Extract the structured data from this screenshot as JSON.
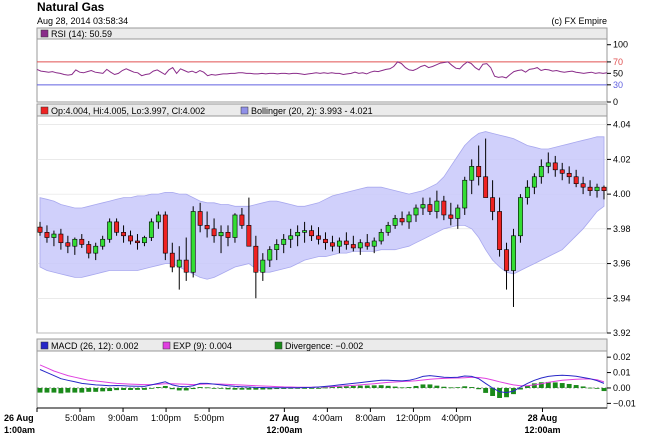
{
  "header": {
    "title": "Natural Gas",
    "timestamp": "Aug 28, 2014 03:58:34",
    "copyright": "(c) FX Empire"
  },
  "colors": {
    "rsi_line": "#8a2c8a",
    "rsi_upper": "#e05050",
    "rsi_lower": "#6060e0",
    "band_fill": "#c8c8fa",
    "band_edge": "#a8a8ee",
    "candle_up": "#33dd33",
    "candle_down": "#ee2222",
    "macd_line": "#2828c8",
    "exp_line": "#e040e0",
    "divergence": "#1a8a1a",
    "panel_header": "#ebebeb",
    "grid": "#dddddd"
  },
  "chart_data": [
    {
      "type": "line",
      "name": "rsi-panel",
      "legend": "RSI (14): 50.59",
      "legend_color": "#8a2c8a",
      "ylim": [
        0,
        110
      ],
      "yticks": [
        100,
        70,
        50,
        30,
        0
      ],
      "levels": [
        70,
        30
      ],
      "values": [
        57,
        54,
        53,
        52,
        53,
        51,
        50,
        48,
        47,
        48,
        56,
        52,
        51,
        53,
        55,
        52,
        51,
        50,
        57,
        52,
        48,
        50,
        55,
        58,
        55,
        52,
        51,
        46,
        48,
        49,
        54,
        56,
        52,
        48,
        56,
        60,
        50,
        58,
        55,
        52,
        54,
        51,
        55,
        52,
        46,
        48,
        47,
        48,
        49,
        49,
        50,
        50,
        51,
        51,
        50,
        50,
        49,
        49,
        50,
        49,
        50,
        50,
        49,
        50,
        50,
        49,
        50,
        50,
        49,
        48,
        49,
        50,
        51,
        50,
        51,
        50,
        51,
        50,
        50,
        48,
        49,
        50,
        52,
        50,
        51,
        49,
        52,
        54,
        53,
        55,
        57,
        58,
        62,
        70,
        67,
        60,
        56,
        55,
        58,
        62,
        64,
        60,
        62,
        65,
        68,
        69,
        70,
        64,
        59,
        58,
        65,
        70,
        67,
        60,
        56,
        66,
        67,
        60,
        45,
        43,
        44,
        42,
        48,
        53,
        55,
        56,
        52,
        57,
        58,
        60,
        55,
        57,
        56,
        54,
        55,
        53,
        52,
        53,
        54,
        52,
        51,
        50,
        51,
        52,
        50,
        51,
        50,
        51
      ]
    },
    {
      "type": "candlestick",
      "name": "price-panel",
      "legend": "Op:4.004, Hi:4.005, Lo:3.997, Cl:4.002",
      "legend_color": "#ee2222",
      "band_legend": "Bollinger (20, 2): 3.993 - 4.021",
      "band_legend_color": "#9090e8",
      "ylim": [
        3.92,
        4.045
      ],
      "yticks": [
        4.04,
        4.02,
        4.0,
        3.98,
        3.96,
        3.94,
        3.92
      ],
      "ytick_labels": [
        "4.04",
        "4.02",
        "4.00",
        "3.98",
        "3.96",
        "3.94",
        "3.92"
      ],
      "candles": [
        [
          3.981,
          3.984,
          3.976,
          3.978
        ],
        [
          3.978,
          3.982,
          3.972,
          3.975
        ],
        [
          3.975,
          3.979,
          3.97,
          3.977
        ],
        [
          3.977,
          3.98,
          3.968,
          3.972
        ],
        [
          3.972,
          3.976,
          3.966,
          3.97
        ],
        [
          3.97,
          3.975,
          3.965,
          3.974
        ],
        [
          3.974,
          3.977,
          3.969,
          3.971
        ],
        [
          3.971,
          3.973,
          3.963,
          3.966
        ],
        [
          3.966,
          3.972,
          3.962,
          3.97
        ],
        [
          3.97,
          3.976,
          3.968,
          3.974
        ],
        [
          3.974,
          3.986,
          3.972,
          3.984
        ],
        [
          3.984,
          3.986,
          3.976,
          3.978
        ],
        [
          3.978,
          3.982,
          3.972,
          3.976
        ],
        [
          3.976,
          3.979,
          3.971,
          3.973
        ],
        [
          3.973,
          3.977,
          3.968,
          3.972
        ],
        [
          3.972,
          3.976,
          3.97,
          3.975
        ],
        [
          3.975,
          3.986,
          3.973,
          3.984
        ],
        [
          3.984,
          3.99,
          3.98,
          3.988
        ],
        [
          3.988,
          3.99,
          3.962,
          3.966
        ],
        [
          3.966,
          3.972,
          3.955,
          3.958
        ],
        [
          3.958,
          3.97,
          3.945,
          3.962
        ],
        [
          3.962,
          3.975,
          3.95,
          3.955
        ],
        [
          3.955,
          3.993,
          3.952,
          3.99
        ],
        [
          3.99,
          3.995,
          3.978,
          3.982
        ],
        [
          3.982,
          3.99,
          3.975,
          3.98
        ],
        [
          3.98,
          3.986,
          3.972,
          3.976
        ],
        [
          3.976,
          3.982,
          3.966,
          3.978
        ],
        [
          3.978,
          3.982,
          3.97,
          3.975
        ],
        [
          3.975,
          3.989,
          3.972,
          3.988
        ],
        [
          3.988,
          3.992,
          3.98,
          3.982
        ],
        [
          3.982,
          3.998,
          3.978,
          3.97
        ],
        [
          3.97,
          3.976,
          3.94,
          3.955
        ],
        [
          3.955,
          3.966,
          3.95,
          3.962
        ],
        [
          3.962,
          3.97,
          3.958,
          3.968
        ],
        [
          3.968,
          3.974,
          3.962,
          3.971
        ],
        [
          3.971,
          3.977,
          3.966,
          3.974
        ],
        [
          3.974,
          3.98,
          3.969,
          3.976
        ],
        [
          3.976,
          3.982,
          3.97,
          3.978
        ],
        [
          3.978,
          3.984,
          3.972,
          3.979
        ],
        [
          3.979,
          3.982,
          3.973,
          3.976
        ],
        [
          3.976,
          3.981,
          3.971,
          3.974
        ],
        [
          3.974,
          3.978,
          3.968,
          3.972
        ],
        [
          3.972,
          3.976,
          3.967,
          3.97
        ],
        [
          3.97,
          3.975,
          3.966,
          3.973
        ],
        [
          3.973,
          3.978,
          3.968,
          3.971
        ],
        [
          3.971,
          3.976,
          3.967,
          3.969
        ],
        [
          3.969,
          3.974,
          3.965,
          3.972
        ],
        [
          3.972,
          3.977,
          3.968,
          3.97
        ],
        [
          3.97,
          3.975,
          3.966,
          3.973
        ],
        [
          3.973,
          3.98,
          3.971,
          3.978
        ],
        [
          3.978,
          3.984,
          3.976,
          3.982
        ],
        [
          3.982,
          3.988,
          3.98,
          3.986
        ],
        [
          3.986,
          3.99,
          3.982,
          3.984
        ],
        [
          3.984,
          3.99,
          3.98,
          3.988
        ],
        [
          3.988,
          3.994,
          3.984,
          3.992
        ],
        [
          3.992,
          3.998,
          3.988,
          3.994
        ],
        [
          3.994,
          3.998,
          3.988,
          3.99
        ],
        [
          3.99,
          4.002,
          3.986,
          3.996
        ],
        [
          3.996,
          3.999,
          3.985,
          3.988
        ],
        [
          3.988,
          3.995,
          3.982,
          3.986
        ],
        [
          3.986,
          3.994,
          3.98,
          3.992
        ],
        [
          3.992,
          4.01,
          3.988,
          4.008
        ],
        [
          4.008,
          4.02,
          4.0,
          4.016
        ],
        [
          4.016,
          4.028,
          4.005,
          4.01
        ],
        [
          4.01,
          4.032,
          4.006,
          3.998
        ],
        [
          3.998,
          4.008,
          3.985,
          3.99
        ],
        [
          3.99,
          3.998,
          3.964,
          3.968
        ],
        [
          3.968,
          3.972,
          3.945,
          3.956
        ],
        [
          3.956,
          3.98,
          3.935,
          3.976
        ],
        [
          3.976,
          4.0,
          3.972,
          3.998
        ],
        [
          3.998,
          4.008,
          3.994,
          4.004
        ],
        [
          4.004,
          4.012,
          4.0,
          4.01
        ],
        [
          4.01,
          4.02,
          4.006,
          4.016
        ],
        [
          4.016,
          4.024,
          4.012,
          4.018
        ],
        [
          4.018,
          4.022,
          4.01,
          4.014
        ],
        [
          4.014,
          4.018,
          4.008,
          4.012
        ],
        [
          4.012,
          4.016,
          4.006,
          4.01
        ],
        [
          4.01,
          4.014,
          4.004,
          4.006
        ],
        [
          4.006,
          4.01,
          4.0,
          4.004
        ],
        [
          4.004,
          4.008,
          3.999,
          4.002
        ],
        [
          4.002,
          4.006,
          3.998,
          4.004
        ],
        [
          4.004,
          4.005,
          3.997,
          4.002
        ]
      ],
      "band_upper": [
        3.998,
        3.997,
        3.996,
        3.994,
        3.993,
        3.992,
        3.992,
        3.993,
        3.994,
        3.995,
        3.996,
        3.997,
        3.998,
        3.998,
        3.999,
        3.999,
        4.0,
        4.0,
        4.001,
        4.001,
        4.0,
        4.0,
        3.998,
        3.996,
        3.995,
        3.995,
        3.994,
        3.994,
        3.993,
        3.993,
        3.993,
        3.994,
        3.995,
        3.996,
        3.996,
        3.995,
        3.994,
        3.993,
        3.993,
        3.994,
        3.995,
        3.997,
        3.999,
        4.0,
        4.001,
        4.002,
        4.003,
        4.004,
        4.004,
        4.004,
        4.003,
        4.002,
        4.001,
        4.0,
        4.001,
        4.002,
        4.004,
        4.006,
        4.01,
        4.016,
        4.022,
        4.028,
        4.032,
        4.035,
        4.036,
        4.035,
        4.034,
        4.033,
        4.032,
        4.03,
        4.028,
        4.027,
        4.026,
        4.026,
        4.027,
        4.028,
        4.029,
        4.03,
        4.031,
        4.032,
        4.033,
        4.033
      ],
      "band_lower": [
        3.958,
        3.956,
        3.955,
        3.954,
        3.953,
        3.952,
        3.952,
        3.953,
        3.954,
        3.955,
        3.956,
        3.956,
        3.956,
        3.956,
        3.956,
        3.957,
        3.958,
        3.959,
        3.96,
        3.96,
        3.958,
        3.956,
        3.954,
        3.952,
        3.951,
        3.952,
        3.954,
        3.956,
        3.958,
        3.959,
        3.96,
        3.957,
        3.955,
        3.955,
        3.956,
        3.957,
        3.958,
        3.96,
        3.962,
        3.963,
        3.964,
        3.964,
        3.965,
        3.966,
        3.966,
        3.967,
        3.967,
        3.967,
        3.967,
        3.968,
        3.968,
        3.968,
        3.969,
        3.97,
        3.972,
        3.974,
        3.976,
        3.978,
        3.98,
        3.981,
        3.982,
        3.982,
        3.98,
        3.975,
        3.968,
        3.962,
        3.958,
        3.955,
        3.954,
        3.956,
        3.958,
        3.96,
        3.962,
        3.964,
        3.966,
        3.968,
        3.972,
        3.976,
        3.98,
        3.985,
        3.99,
        3.993
      ]
    },
    {
      "type": "line",
      "name": "macd-panel",
      "ylim": [
        -0.013,
        0.024
      ],
      "yticks": [
        0.02,
        0.01,
        0.0,
        -0.01
      ],
      "ytick_labels": [
        "0.02",
        "0.01",
        "0.00",
        "−0.01"
      ],
      "legend": [
        {
          "label": "MACD (26, 12): 0.002",
          "color": "#2828c8"
        },
        {
          "label": "EXP (9): 0.004",
          "color": "#e040e0"
        },
        {
          "label": "Divergence: −0.002",
          "color": "#1a8a1a"
        }
      ],
      "series": [
        {
          "values": [
            0.012,
            0.01,
            0.008,
            0.006,
            0.005,
            0.004,
            0.003,
            0.0025,
            0.002,
            0.0018,
            0.0015,
            0.0016,
            0.0014,
            0.0012,
            0.0011,
            0.001,
            0.002,
            0.003,
            0.004,
            0.002,
            0.001,
            0.0008,
            0.0015,
            0.003,
            0.003,
            0.0025,
            0.002,
            0.0014,
            0.001,
            0.0008,
            0.0006,
            0.0004,
            0.0003,
            0.0002,
            0.0002,
            0.0001,
            0.0001,
            0.0002,
            0.0003,
            0.0004,
            0.0006,
            0.001,
            0.0015,
            0.002,
            0.0025,
            0.003,
            0.0035,
            0.004,
            0.0045,
            0.005,
            0.005,
            0.0048,
            0.0046,
            0.005,
            0.006,
            0.0075,
            0.008,
            0.0075,
            0.007,
            0.0068,
            0.007,
            0.0078,
            0.0075,
            0.006,
            0.003,
            0.0,
            -0.0025,
            -0.003,
            -0.002,
            0.0005,
            0.003,
            0.005,
            0.0065,
            0.0075,
            0.008,
            0.0082,
            0.008,
            0.0076,
            0.0068,
            0.006,
            0.0048,
            0.003
          ]
        },
        {
          "values": [
            0.015,
            0.013,
            0.011,
            0.0095,
            0.008,
            0.007,
            0.006,
            0.005,
            0.0045,
            0.004,
            0.0035,
            0.003,
            0.0027,
            0.0025,
            0.0023,
            0.0022,
            0.0022,
            0.0024,
            0.0027,
            0.0028,
            0.0026,
            0.0024,
            0.0022,
            0.0024,
            0.0026,
            0.0026,
            0.0025,
            0.0023,
            0.0021,
            0.0019,
            0.0017,
            0.0015,
            0.0013,
            0.0011,
            0.0009,
            0.0007,
            0.0006,
            0.0005,
            0.0005,
            0.0005,
            0.0006,
            0.0007,
            0.0009,
            0.0011,
            0.0014,
            0.0017,
            0.002,
            0.0024,
            0.0028,
            0.0032,
            0.0036,
            0.0039,
            0.0042,
            0.0044,
            0.0047,
            0.0052,
            0.0057,
            0.006,
            0.0062,
            0.0064,
            0.0065,
            0.0067,
            0.0069,
            0.0068,
            0.0062,
            0.0052,
            0.004,
            0.003,
            0.002,
            0.0015,
            0.0015,
            0.002,
            0.0028,
            0.0036,
            0.0044,
            0.005,
            0.0054,
            0.0057,
            0.0058,
            0.0058,
            0.0053,
            0.004
          ]
        },
        {
          "type": "bar",
          "values": [
            -0.003,
            -0.003,
            -0.003,
            -0.0035,
            -0.003,
            -0.003,
            -0.003,
            -0.0025,
            -0.0025,
            -0.0022,
            -0.002,
            -0.0014,
            -0.0013,
            -0.0013,
            -0.0012,
            -0.0012,
            -0.0002,
            0.0006,
            0.0013,
            -0.0008,
            -0.0016,
            -0.0016,
            -0.0007,
            0.0006,
            0.0004,
            -0.0001,
            -0.0005,
            -0.0009,
            -0.0011,
            -0.0011,
            -0.0011,
            -0.0011,
            -0.001,
            -0.0009,
            -0.0007,
            -0.0006,
            -0.0005,
            -0.0003,
            -0.0002,
            -0.0001,
            0.0,
            0.0003,
            0.0006,
            0.0009,
            0.0011,
            0.0013,
            0.0015,
            0.0016,
            0.0017,
            0.0018,
            0.0014,
            0.0009,
            0.0004,
            0.0006,
            0.0013,
            0.0023,
            0.0023,
            0.0015,
            0.0008,
            0.0004,
            0.0005,
            0.0011,
            0.0006,
            -0.0008,
            -0.0032,
            -0.0052,
            -0.0065,
            -0.006,
            -0.004,
            -0.001,
            0.0015,
            0.003,
            0.0037,
            0.0039,
            0.0036,
            0.0032,
            0.0026,
            0.0019,
            0.001,
            0.0002,
            -0.0005,
            -0.002
          ]
        }
      ]
    }
  ],
  "x_axis": {
    "ticks": [
      {
        "label": "26 Aug",
        "sub": "1:00am",
        "bold": true,
        "pos": 0
      },
      {
        "label": "5:00am",
        "sub": "",
        "bold": false,
        "pos": 4
      },
      {
        "label": "9:00am",
        "sub": "",
        "bold": false,
        "pos": 8
      },
      {
        "label": "1:00pm",
        "sub": "",
        "bold": false,
        "pos": 12
      },
      {
        "label": "5:00pm",
        "sub": "",
        "bold": false,
        "pos": 16
      },
      {
        "label": "27 Aug",
        "sub": "12:00am",
        "bold": true,
        "pos": 23
      },
      {
        "label": "4:00am",
        "sub": "",
        "bold": false,
        "pos": 27
      },
      {
        "label": "8:00am",
        "sub": "",
        "bold": false,
        "pos": 31
      },
      {
        "label": "12:00pm",
        "sub": "",
        "bold": false,
        "pos": 35
      },
      {
        "label": "4:00pm",
        "sub": "",
        "bold": false,
        "pos": 39
      },
      {
        "label": "28 Aug",
        "sub": "12:00am",
        "bold": true,
        "pos": 47
      }
    ],
    "span": 53
  }
}
